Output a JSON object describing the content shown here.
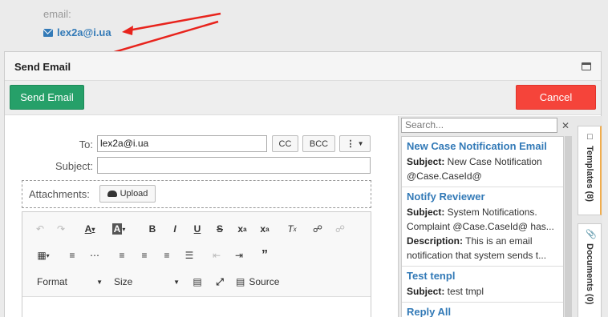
{
  "contact": {
    "email_label": "email:",
    "email_value": "lex2a@i.ua"
  },
  "dialog": {
    "title": "Send Email"
  },
  "actions": {
    "send_label": "Send Email",
    "cancel_label": "Cancel"
  },
  "form": {
    "to_label": "To:",
    "to_value": "lex2a@i.ua",
    "cc_label": "CC",
    "bcc_label": "BCC",
    "subject_label": "Subject:",
    "subject_value": "",
    "attachments_label": "Attachments:",
    "upload_label": "Upload"
  },
  "editor": {
    "format_label": "Format",
    "size_label": "Size",
    "source_label": "Source",
    "icons": [
      "undo-icon",
      "redo-icon",
      "text-color-icon",
      "bg-color-icon",
      "bold-icon",
      "italic-icon",
      "underline-icon",
      "strike-icon",
      "subscript-icon",
      "superscript-icon",
      "remove-format-icon",
      "link-icon",
      "unlink-icon",
      "table-icon",
      "numbered-list-icon",
      "bullet-list-icon",
      "align-left-icon",
      "align-center-icon",
      "align-right-icon",
      "justify-icon",
      "outdent-icon",
      "indent-icon",
      "blockquote-icon",
      "maximize-icon",
      "fullscreen-icon",
      "source-icon"
    ]
  },
  "templates": {
    "search_placeholder": "Search...",
    "items": [
      {
        "title": "New Case Notification Email",
        "subject_key": "Subject:",
        "subject_text": " New Case Notification",
        "subject_text2": "@Case.CaseId@"
      },
      {
        "title": "Notify Reviewer",
        "subject_key": "Subject:",
        "subject_text": " System Notifications.",
        "subject_text2": "Complaint @Case.CaseId@ has...",
        "desc_key": "Description:",
        "desc_text": " This is an email",
        "desc_text2": "notification that system sends t..."
      },
      {
        "title": "Test tenpl",
        "subject_key": "Subject:",
        "subject_text": " test tmpl"
      },
      {
        "title": "Reply All"
      }
    ]
  },
  "side_tabs": {
    "templates_label": "Templates (8)",
    "documents_label": "Documents (0)"
  },
  "colors": {
    "send": "#26a069",
    "cancel": "#f5443a",
    "link": "#337ab7",
    "arrow": "#e8231c"
  }
}
